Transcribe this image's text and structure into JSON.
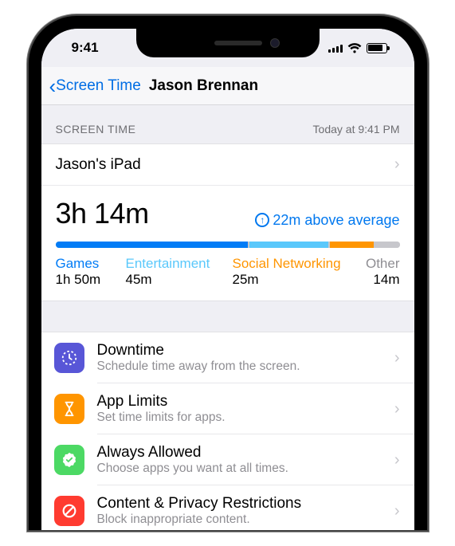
{
  "status": {
    "time": "9:41"
  },
  "nav": {
    "back": "Screen Time",
    "title": "Jason Brennan"
  },
  "section": {
    "label": "SCREEN TIME",
    "timestamp": "Today at 9:41 PM"
  },
  "device": {
    "name": "Jason's iPad"
  },
  "usage": {
    "total": "3h 14m",
    "compare": "22m above average",
    "categories": {
      "games": {
        "label": "Games",
        "value": "1h 50m"
      },
      "ent": {
        "label": "Entertainment",
        "value": "45m"
      },
      "social": {
        "label": "Social Networking",
        "value": "25m"
      },
      "other": {
        "label": "Other",
        "value": "14m"
      }
    }
  },
  "options": {
    "downtime": {
      "title": "Downtime",
      "subtitle": "Schedule time away from the screen."
    },
    "applimits": {
      "title": "App Limits",
      "subtitle": "Set time limits for apps."
    },
    "allowed": {
      "title": "Always Allowed",
      "subtitle": "Choose apps you want at all times."
    },
    "privacy": {
      "title": "Content & Privacy Restrictions",
      "subtitle": "Block inappropriate content."
    }
  },
  "chart_data": {
    "type": "bar",
    "title": "Screen Time breakdown",
    "categories": [
      "Games",
      "Entertainment",
      "Social Networking",
      "Other"
    ],
    "values_minutes": [
      110,
      45,
      25,
      14
    ],
    "total_label": "3h 14m",
    "colors": [
      "#027cf6",
      "#5ac8fb",
      "#ff9500",
      "#c7c7cc"
    ]
  }
}
